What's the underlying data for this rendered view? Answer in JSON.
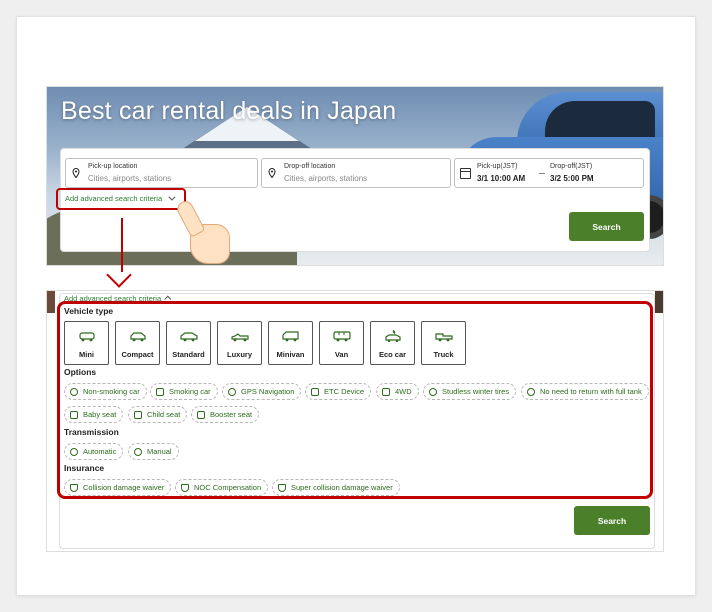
{
  "hero": {
    "title": "Best car rental deals in Japan"
  },
  "search": {
    "pickup_label": "Pick-up location",
    "pickup_placeholder": "Cities, airports, stations",
    "dropoff_label": "Drop-off location",
    "dropoff_placeholder": "Cities, airports, stations",
    "pickup_time_label": "Pick-up(JST)",
    "pickup_time_value": "3/1 10:00 AM",
    "dropoff_time_label": "Drop-off(JST)",
    "dropoff_time_value": "3/2 5:00 PM",
    "advanced_label": "Add advanced search criteria",
    "search_button": "Search"
  },
  "advanced": {
    "toggle_label": "Add advanced search criteria",
    "vehicle_type_title": "Vehicle type",
    "vehicle_types": [
      "Mini",
      "Compact",
      "Standard",
      "Luxury",
      "Minivan",
      "Van",
      "Eco car",
      "Truck"
    ],
    "options_title": "Options",
    "options": [
      "Non-smoking car",
      "Smoking car",
      "GPS Navigation",
      "ETC Device",
      "4WD",
      "Studless winter tires",
      "No need to return with full tank",
      "Baby seat",
      "Child seat",
      "Booster seat"
    ],
    "transmission_title": "Transmission",
    "transmission": [
      "Automatic",
      "Manual"
    ],
    "insurance_title": "Insurance",
    "insurance": [
      "Collision damage waiver",
      "NOC Compensation",
      "Super collision damage waiver"
    ],
    "search_button": "Search"
  },
  "colors": {
    "accent_green": "#4b7f2a",
    "highlight_red": "#c00000",
    "chip_text": "#2e6b1f"
  }
}
